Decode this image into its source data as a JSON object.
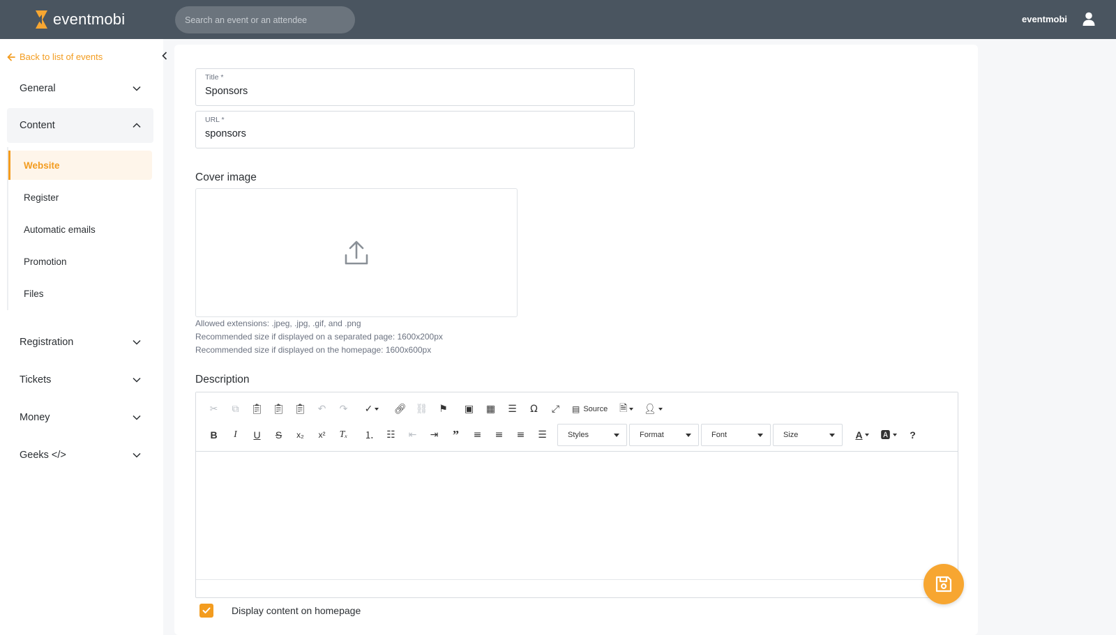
{
  "brand": {
    "name": "eventmobi",
    "accent": "#f39c1f",
    "topbar_bg": "#4a5560"
  },
  "header": {
    "search": {
      "placeholder": "Search an event or an attendee",
      "value": ""
    },
    "user_name": "eventmobi",
    "user_icon": "user-icon"
  },
  "sidebar": {
    "back_label": "Back to list of events",
    "sections": [
      {
        "label": "General",
        "expanded": false
      },
      {
        "label": "Content",
        "expanded": true
      },
      {
        "label": "Registration",
        "expanded": false
      },
      {
        "label": "Tickets",
        "expanded": false
      },
      {
        "label": "Money",
        "expanded": false
      },
      {
        "label": "Geeks </>",
        "expanded": false
      }
    ],
    "content_items": [
      {
        "label": "Website",
        "active": true
      },
      {
        "label": "Register",
        "active": false
      },
      {
        "label": "Automatic emails",
        "active": false
      },
      {
        "label": "Promotion",
        "active": false
      },
      {
        "label": "Files",
        "active": false
      }
    ]
  },
  "form": {
    "title": {
      "label": "Title *",
      "value": "Sponsors"
    },
    "url": {
      "label": "URL *",
      "value": "sponsors"
    },
    "cover_image": {
      "heading": "Cover image",
      "hints": [
        "Allowed extensions: .jpeg, .jpg, .gif, and .png",
        "Recommended size if displayed on a separated page: 1600x200px",
        "Recommended size if displayed on the homepage: 1600x600px"
      ]
    },
    "description": {
      "heading": "Description",
      "toolbar": {
        "source_label": "Source",
        "styles_label": "Styles",
        "format_label": "Format",
        "font_label": "Font",
        "size_label": "Size"
      }
    },
    "display_on_homepage": {
      "label": "Display content on homepage",
      "checked": true
    }
  }
}
